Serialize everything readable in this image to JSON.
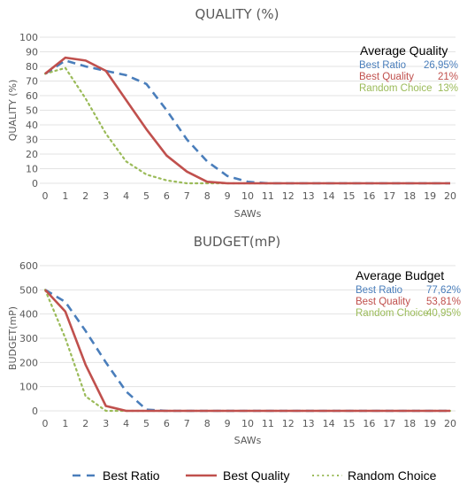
{
  "colors": {
    "best_ratio": "#4a7ebb",
    "best_quality": "#c0504d",
    "random_choice": "#9bbb59",
    "grid": "#e3e3e3",
    "text": "#595959"
  },
  "legend": [
    {
      "name": "Best Ratio",
      "style": "dashed",
      "color_key": "best_ratio"
    },
    {
      "name": "Best Quality",
      "style": "solid",
      "color_key": "best_quality"
    },
    {
      "name": "Random Choice",
      "style": "dotted",
      "color_key": "random_choice"
    }
  ],
  "chart_data": [
    {
      "type": "line",
      "title": "QUALITY (%)",
      "xlabel": "SAWs",
      "ylabel": "QUALITY  (%)",
      "x": [
        0,
        1,
        2,
        3,
        4,
        5,
        6,
        7,
        8,
        9,
        10,
        11,
        12,
        13,
        14,
        15,
        16,
        17,
        18,
        19,
        20
      ],
      "xticks": [
        "0",
        "1",
        "2",
        "3",
        "4",
        "5",
        "6",
        "7",
        "8",
        "9",
        "10",
        "11",
        "12",
        "13",
        "14",
        "15",
        "16",
        "17",
        "18",
        "19",
        "20"
      ],
      "ylim": [
        0,
        100
      ],
      "yticks": [
        "0",
        "10",
        "20",
        "30",
        "40",
        "50",
        "60",
        "70",
        "80",
        "90",
        "100"
      ],
      "grid": true,
      "series": [
        {
          "name": "Best Ratio",
          "values": [
            75,
            84,
            80,
            77,
            74,
            68,
            50,
            30,
            15,
            5,
            1,
            0,
            0,
            0,
            0,
            0,
            0,
            0,
            0,
            0,
            0
          ]
        },
        {
          "name": "Best Quality",
          "values": [
            75,
            86,
            84,
            77,
            57,
            37,
            19,
            8,
            1,
            0,
            0,
            0,
            0,
            0,
            0,
            0,
            0,
            0,
            0,
            0,
            0
          ]
        },
        {
          "name": "Random Choice",
          "values": [
            75,
            79,
            58,
            34,
            15,
            6,
            2,
            0,
            0,
            0,
            0,
            0,
            0,
            0,
            0,
            0,
            0,
            0,
            0,
            0,
            0
          ]
        }
      ],
      "annotation": {
        "heading": "Average Quality",
        "rows": [
          {
            "label": "Best Ratio",
            "value": "26,95%"
          },
          {
            "label": "Best Quality",
            "value": "21%"
          },
          {
            "label": "Random Choice",
            "value": "13%"
          }
        ]
      }
    },
    {
      "type": "line",
      "title": "BUDGET(mP)",
      "xlabel": "SAWs",
      "ylabel": "BUDGET(mP)",
      "x": [
        0,
        1,
        2,
        3,
        4,
        5,
        6,
        7,
        8,
        9,
        10,
        11,
        12,
        13,
        14,
        15,
        16,
        17,
        18,
        19,
        20
      ],
      "xticks": [
        "0",
        "1",
        "2",
        "3",
        "4",
        "5",
        "6",
        "7",
        "8",
        "9",
        "10",
        "11",
        "12",
        "13",
        "14",
        "15",
        "16",
        "17",
        "18",
        "19",
        "20"
      ],
      "ylim": [
        0,
        600
      ],
      "yticks": [
        "0",
        "100",
        "200",
        "300",
        "400",
        "500",
        "600"
      ],
      "grid": true,
      "series": [
        {
          "name": "Best Ratio",
          "values": [
            500,
            450,
            330,
            200,
            80,
            5,
            0,
            0,
            0,
            0,
            0,
            0,
            0,
            0,
            0,
            0,
            0,
            0,
            0,
            0,
            0
          ]
        },
        {
          "name": "Best Quality",
          "values": [
            500,
            410,
            190,
            20,
            0,
            0,
            0,
            0,
            0,
            0,
            0,
            0,
            0,
            0,
            0,
            0,
            0,
            0,
            0,
            0,
            0
          ]
        },
        {
          "name": "Random Choice",
          "values": [
            500,
            300,
            60,
            0,
            0,
            0,
            0,
            0,
            0,
            0,
            0,
            0,
            0,
            0,
            0,
            0,
            0,
            0,
            0,
            0,
            0
          ]
        }
      ],
      "annotation": {
        "heading": "Average   Budget",
        "rows": [
          {
            "label": "Best Ratio",
            "value": "77,62%"
          },
          {
            "label": "Best Quality",
            "value": "53,81%"
          },
          {
            "label": "Random Choice",
            "value": "40,95%"
          }
        ]
      }
    }
  ]
}
